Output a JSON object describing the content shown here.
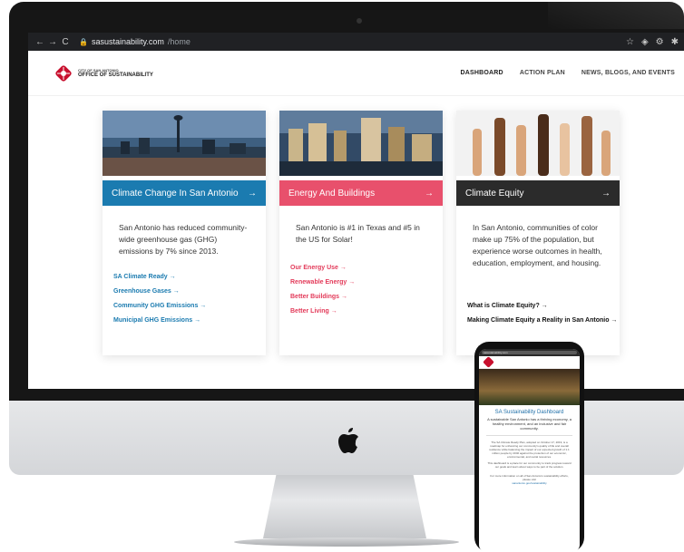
{
  "browser": {
    "url_host": "sasustainability.com",
    "url_path": "/home",
    "back_glyph": "←",
    "forward_glyph": "→",
    "reload_glyph": "C",
    "lock_glyph": "🔒",
    "star_glyph": "☆",
    "shield_glyph": "◈",
    "gear_glyph": "⚙",
    "puzzle_glyph": "✱"
  },
  "site": {
    "logo_small": "CITY OF SAN ANTONIO",
    "logo_big": "OFFICE OF SUSTAINABILITY",
    "nav": [
      "DASHBOARD",
      "ACTION PLAN",
      "NEWS, BLOGS, AND EVENTS"
    ]
  },
  "cards": [
    {
      "title": "Climate Change In San Antonio",
      "arrow": "→",
      "color": "#1b7bb0",
      "body": "San Antonio has reduced community-wide greenhouse gas (GHG) emissions by 7% since 2013.",
      "link_color": "#1b7bb0",
      "links": [
        "SA Climate Ready →",
        "Greenhouse Gases →",
        "Community GHG Emissions →",
        "Municipal GHG Emissions →"
      ]
    },
    {
      "title": "Energy And Buildings",
      "arrow": "→",
      "color": "#e8506c",
      "body": "San Antonio is #1 in Texas and #5 in the US for Solar!",
      "link_color": "#e33b5a",
      "links": [
        "Our Energy Use →",
        "Renewable Energy →",
        "Better Buildings →",
        "Better Living →"
      ]
    },
    {
      "title": "Climate Equity",
      "arrow": "→",
      "color": "#2b2b2b",
      "body": "In San Antonio, communities of color make up 75% of the population, but experience worse outcomes in health, education, employment, and housing.",
      "link_color": "#111111",
      "links": [
        "What is Climate Equity? →",
        "Making Climate Equity a Reality in San Antonio →"
      ]
    }
  ],
  "phone": {
    "url": "sasustainability.com",
    "title": "SA Sustainability Dashboard",
    "subtitle": "A sustainable San Antonio has a thriving economy, a healthy environment, and an inclusive and fair community.",
    "para1": "The SA Climate Ready Plan, adopted on October 17, 2019, is a roadmap for enhancing our community's quality of life and overall resilience while balancing the impact of our expected growth of 1.1 million people by 2040 against the protection of our economic, environmental, and social resources.",
    "para2": "This dashboard is a place for our community to track progress toward our goals and learn about ways to be part of the solution.",
    "para3": "For more information on all of San Antonio's sustainability efforts, please visit",
    "link": "sanantonio.gov/sustainability"
  }
}
